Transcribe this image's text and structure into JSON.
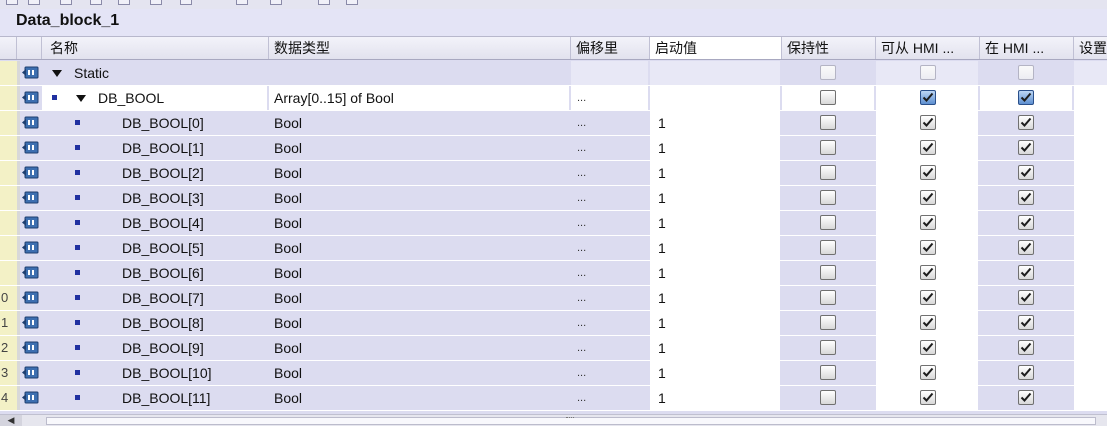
{
  "window": {
    "title": "Data_block_1"
  },
  "columns": {
    "name": "名称",
    "datatype": "数据类型",
    "offset": "偏移里",
    "start_value": "启动值",
    "retain": "保持性",
    "hmi_accessible": "可从 HMI ...",
    "hmi_visible": "在 HMI ...",
    "setpoint": "设置"
  },
  "rows": [
    {
      "num": "",
      "name": "Static",
      "datatype": "",
      "offset": "",
      "start": "",
      "retain": false,
      "hmi1": false,
      "hmi2": false,
      "level": 0,
      "expander": true,
      "bullet": false
    },
    {
      "num": "",
      "name": "DB_BOOL",
      "datatype": "Array[0..15] of Bool",
      "offset": "...",
      "start": "",
      "retain": false,
      "hmi1": true,
      "hmi2": true,
      "level": 1,
      "expander": true,
      "bullet": true
    },
    {
      "num": "",
      "name": "DB_BOOL[0]",
      "datatype": "Bool",
      "offset": "...",
      "start": "1",
      "retain": false,
      "hmi1": true,
      "hmi2": true,
      "level": 2
    },
    {
      "num": "",
      "name": "DB_BOOL[1]",
      "datatype": "Bool",
      "offset": "...",
      "start": "1",
      "retain": false,
      "hmi1": true,
      "hmi2": true,
      "level": 2
    },
    {
      "num": "",
      "name": "DB_BOOL[2]",
      "datatype": "Bool",
      "offset": "...",
      "start": "1",
      "retain": false,
      "hmi1": true,
      "hmi2": true,
      "level": 2
    },
    {
      "num": "",
      "name": "DB_BOOL[3]",
      "datatype": "Bool",
      "offset": "...",
      "start": "1",
      "retain": false,
      "hmi1": true,
      "hmi2": true,
      "level": 2
    },
    {
      "num": "",
      "name": "DB_BOOL[4]",
      "datatype": "Bool",
      "offset": "...",
      "start": "1",
      "retain": false,
      "hmi1": true,
      "hmi2": true,
      "level": 2
    },
    {
      "num": "",
      "name": "DB_BOOL[5]",
      "datatype": "Bool",
      "offset": "...",
      "start": "1",
      "retain": false,
      "hmi1": true,
      "hmi2": true,
      "level": 2
    },
    {
      "num": "",
      "name": "DB_BOOL[6]",
      "datatype": "Bool",
      "offset": "...",
      "start": "1",
      "retain": false,
      "hmi1": true,
      "hmi2": true,
      "level": 2
    },
    {
      "num": "0",
      "name": "DB_BOOL[7]",
      "datatype": "Bool",
      "offset": "...",
      "start": "1",
      "retain": false,
      "hmi1": true,
      "hmi2": true,
      "level": 2
    },
    {
      "num": "1",
      "name": "DB_BOOL[8]",
      "datatype": "Bool",
      "offset": "...",
      "start": "1",
      "retain": false,
      "hmi1": true,
      "hmi2": true,
      "level": 2
    },
    {
      "num": "2",
      "name": "DB_BOOL[9]",
      "datatype": "Bool",
      "offset": "...",
      "start": "1",
      "retain": false,
      "hmi1": true,
      "hmi2": true,
      "level": 2
    },
    {
      "num": "3",
      "name": "DB_BOOL[10]",
      "datatype": "Bool",
      "offset": "...",
      "start": "1",
      "retain": false,
      "hmi1": true,
      "hmi2": true,
      "level": 2
    },
    {
      "num": "4",
      "name": "DB_BOOL[11]",
      "datatype": "Bool",
      "offset": "...",
      "start": "1",
      "retain": false,
      "hmi1": true,
      "hmi2": true,
      "level": 2
    }
  ],
  "scrollbar": {
    "left_arrow": "◀",
    "grip": ""
  },
  "colors": {
    "row_bg": "#dcdcf0",
    "number_col": "#f3f1c6",
    "selected_row": "#ffffff",
    "checkbox_blue": "#5d8fd0"
  }
}
